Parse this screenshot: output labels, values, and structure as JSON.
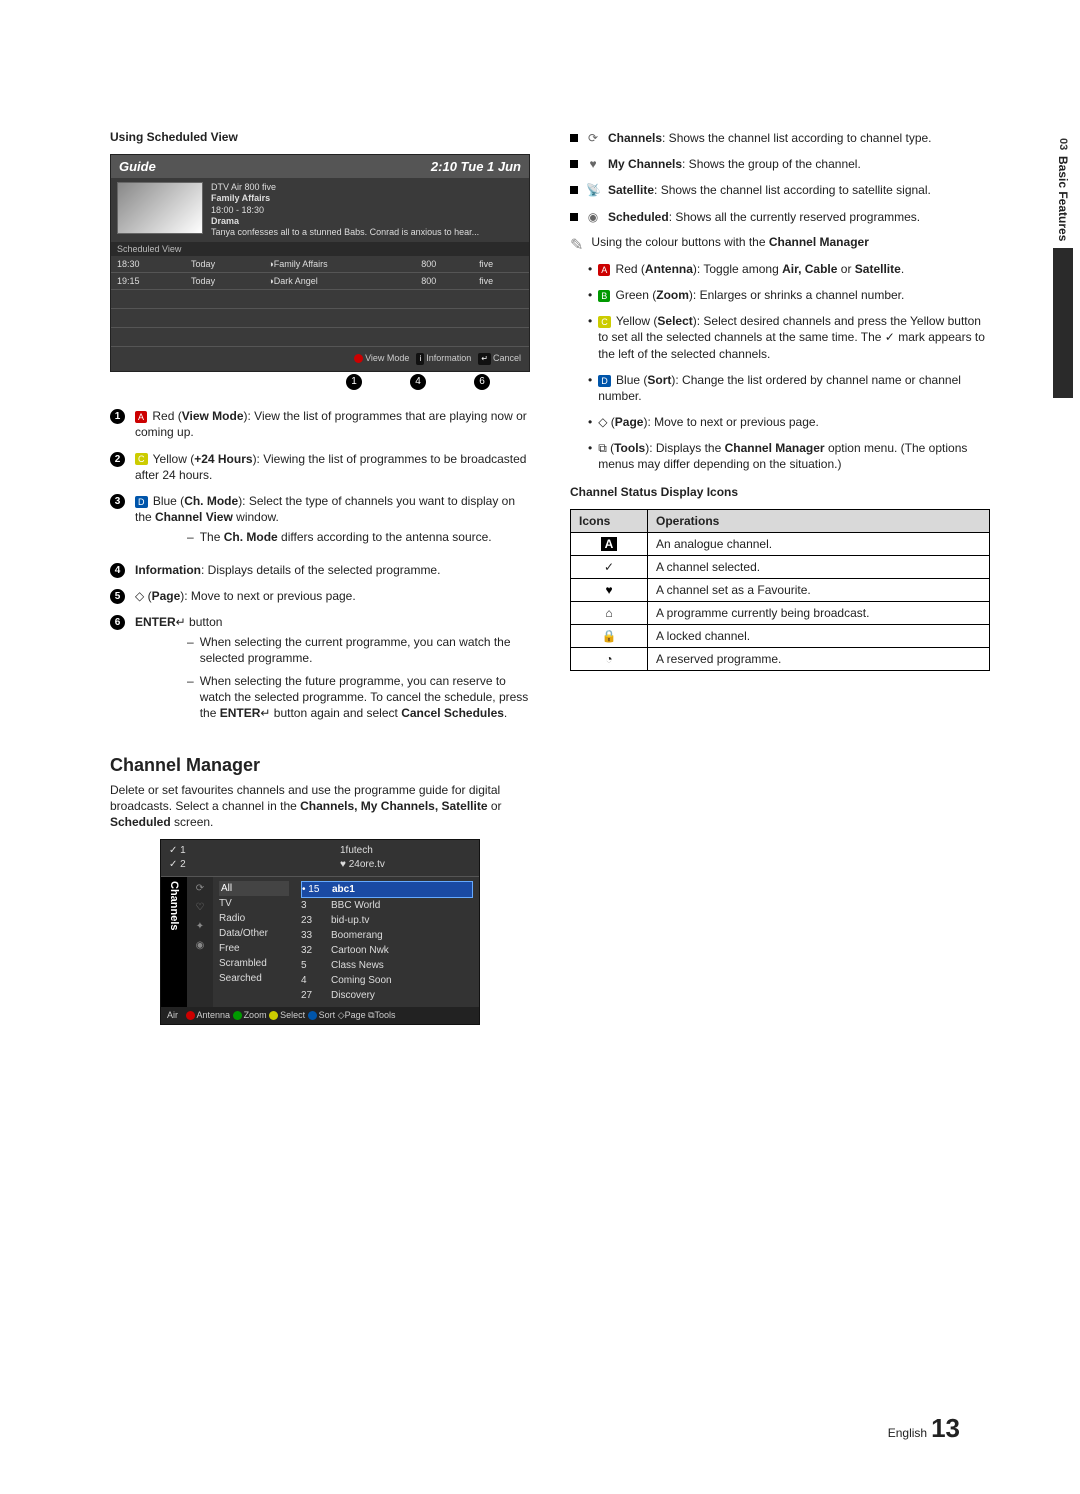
{
  "sideTab": {
    "num": "03",
    "label": "Basic Features"
  },
  "left": {
    "heading": "Using Scheduled View",
    "guide": {
      "title": "Guide",
      "time": "2:10 Tue 1 Jun",
      "info1": "DTV Air 800 five",
      "info2": "Family Affairs",
      "info3": "18:00 - 18:30",
      "info4": "Drama",
      "info5": "Tanya confesses all to a stunned Babs. Conrad is anxious to hear...",
      "schedLabel": "Scheduled View",
      "rows": [
        {
          "t": "18:30",
          "d": "Today",
          "p": "Family Affairs",
          "ch": "800",
          "n": "five"
        },
        {
          "t": "19:15",
          "d": "Today",
          "p": "Dark Angel",
          "ch": "800",
          "n": "five"
        }
      ],
      "footer": {
        "view": "View Mode",
        "info": "Information",
        "cancel": "Cancel"
      }
    },
    "callouts": [
      "1",
      "4",
      "6"
    ],
    "numlist": [
      {
        "n": "1",
        "pre": "Red (",
        "b": "View Mode",
        "post": "): View the list of programmes that are playing now or coming up.",
        "chip": "A",
        "chipClass": "red"
      },
      {
        "n": "2",
        "pre": "Yellow (",
        "b": "+24 Hours",
        "post": "): Viewing the list of programmes to be broadcasted after 24 hours.",
        "chip": "C",
        "chipClass": "yellow"
      },
      {
        "n": "3",
        "pre": "Blue (",
        "b": "Ch. Mode",
        "post": "): Select the type of channels you want to display on the <b>Channel View</b> window.",
        "chip": "D",
        "chipClass": "blue",
        "sub": [
          "The <b>Ch. Mode</b> differs according to the antenna source."
        ]
      },
      {
        "n": "4",
        "b": "Information",
        "post": ": Displays details of the selected programme."
      },
      {
        "n": "5",
        "pre": "◇ (",
        "b": "Page",
        "post": "): Move to next or previous page."
      },
      {
        "n": "6",
        "b": "ENTER",
        "icon": "↵",
        "post": " button",
        "sub": [
          "When selecting the current programme, you can watch the selected programme.",
          "When selecting the future programme, you can reserve to watch the selected programme. To cancel the schedule, press the <b>ENTER</b>↵ button again and select <b>Cancel Schedules</b>."
        ]
      }
    ],
    "cmTitle": "Channel Manager",
    "cmIntro": "Delete or set favourites channels and use the programme guide for digital broadcasts. Select a channel in the <b>Channels, My Channels, Satellite</b> or <b>Scheduled</b> screen.",
    "cm": {
      "tab": "Channels",
      "hdrLeft": [
        "✓ 1",
        "✓ 2"
      ],
      "hdrRight": [
        "1futech",
        "♥ 24ore.tv"
      ],
      "cats": [
        "All",
        "TV",
        "Radio",
        "Data/Other",
        "Free",
        "Scrambled",
        "Searched"
      ],
      "listSelNum": "15",
      "listSelName": "abc1",
      "list": [
        {
          "n": "3",
          "name": "BBC World"
        },
        {
          "n": "23",
          "name": "bid-up.tv"
        },
        {
          "n": "33",
          "name": "Boomerang"
        },
        {
          "n": "32",
          "name": "Cartoon Nwk"
        },
        {
          "n": "5",
          "name": "Class News"
        },
        {
          "n": "4",
          "name": "Coming Soon"
        },
        {
          "n": "27",
          "name": "Discovery"
        }
      ],
      "footerLeft": "Air",
      "footer": {
        "a": "Antenna",
        "b": "Zoom",
        "c": "Select",
        "d": "Sort",
        "e": "Page",
        "f": "Tools"
      }
    }
  },
  "right": {
    "iconList": [
      {
        "ic": "⟳",
        "b": "Channels",
        "t": ": Shows the channel list according to channel type."
      },
      {
        "ic": "♥",
        "b": "My Channels",
        "t": ": Shows the group of the channel."
      },
      {
        "ic": "📡",
        "b": "Satellite",
        "t": ": Shows the channel list according to satellite signal."
      },
      {
        "ic": "◉",
        "b": "Scheduled",
        "t": ": Shows all the currently reserved programmes."
      }
    ],
    "note": "Using the colour buttons with the <b>Channel Manager</b>",
    "ul": [
      {
        "chip": "A",
        "cls": "red",
        "pre": "Red (",
        "b": "Antenna",
        "post": "): Toggle among <b>Air, Cable</b> or <b>Satellite</b>."
      },
      {
        "chip": "B",
        "cls": "green",
        "pre": "Green (",
        "b": "Zoom",
        "post": "): Enlarges or shrinks a channel number."
      },
      {
        "chip": "C",
        "cls": "yellow",
        "pre": "Yellow (",
        "b": "Select",
        "post": "): Select desired channels and press the Yellow button to set all the selected channels at the same time. The ✓ mark appears to the left of the selected channels."
      },
      {
        "chip": "D",
        "cls": "blue",
        "pre": "Blue (",
        "b": "Sort",
        "post": "): Change the list ordered by channel name or channel number."
      },
      {
        "pre": "◇ (",
        "b": "Page",
        "post": "): Move to next or previous page."
      },
      {
        "pre": "⧉ (",
        "b": "Tools",
        "post": "): Displays the <b>Channel Manager</b> option menu. (The options menus may differ depending on the situation.)"
      }
    ],
    "statusTitle": "Channel Status Display Icons",
    "status": {
      "h1": "Icons",
      "h2": "Operations",
      "rows": [
        {
          "i": "A",
          "t": "An analogue channel."
        },
        {
          "i": "✓",
          "t": "A channel selected."
        },
        {
          "i": "♥",
          "t": "A channel set as a Favourite."
        },
        {
          "i": "⌂",
          "t": "A programme currently being broadcast."
        },
        {
          "i": "🔒",
          "t": "A locked channel."
        },
        {
          "i": "◔",
          "t": "A reserved programme."
        }
      ]
    }
  },
  "footer": {
    "lang": "English",
    "page": "13"
  }
}
